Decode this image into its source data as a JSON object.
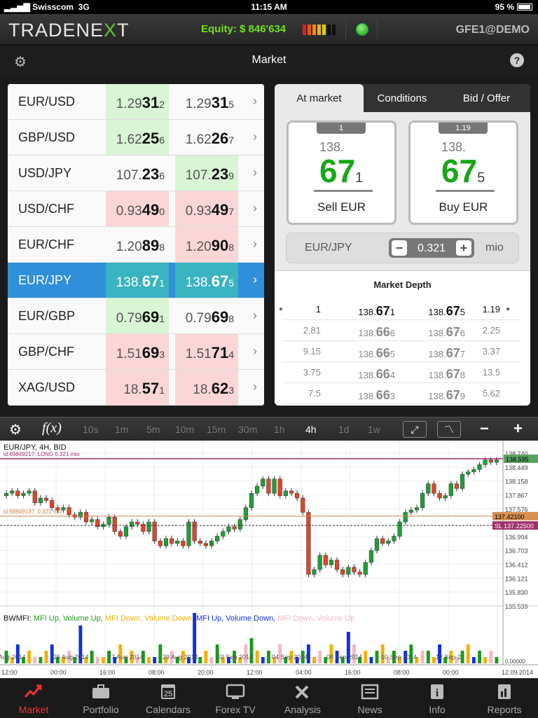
{
  "status": {
    "carrier": "Swisscom",
    "network": "3G",
    "time": "11:15 AM",
    "battery": "95 %"
  },
  "header": {
    "logo": "TRADENEXT",
    "equity": "Equity: $ 846'634",
    "user": "GFE1@DEMO"
  },
  "title": "Market",
  "quotes": [
    {
      "symbol": "EUR/USD",
      "bid_pre": "1.29",
      "bid_big": "31",
      "bid_sm": "2",
      "ask_pre": "1.29",
      "ask_big": "31",
      "ask_sm": "5",
      "bid_dir": "up",
      "ask_dir": ""
    },
    {
      "symbol": "GBP/USD",
      "bid_pre": "1.62",
      "bid_big": "25",
      "bid_sm": "6",
      "ask_pre": "1.62",
      "ask_big": "26",
      "ask_sm": "7",
      "bid_dir": "up",
      "ask_dir": ""
    },
    {
      "symbol": "USD/JPY",
      "bid_pre": "107.",
      "bid_big": "23",
      "bid_sm": "6",
      "ask_pre": "107.",
      "ask_big": "23",
      "ask_sm": "9",
      "bid_dir": "",
      "ask_dir": "up"
    },
    {
      "symbol": "USD/CHF",
      "bid_pre": "0.93",
      "bid_big": "49",
      "bid_sm": "0",
      "ask_pre": "0.93",
      "ask_big": "49",
      "ask_sm": "7",
      "bid_dir": "dn",
      "ask_dir": "dn"
    },
    {
      "symbol": "EUR/CHF",
      "bid_pre": "1.20",
      "bid_big": "89",
      "bid_sm": "8",
      "ask_pre": "1.20",
      "ask_big": "90",
      "ask_sm": "8",
      "bid_dir": "",
      "ask_dir": "dn"
    },
    {
      "symbol": "EUR/JPY",
      "bid_pre": "138.",
      "bid_big": "67",
      "bid_sm": "1",
      "ask_pre": "138.",
      "ask_big": "67",
      "ask_sm": "5",
      "bid_dir": "",
      "ask_dir": ""
    },
    {
      "symbol": "EUR/GBP",
      "bid_pre": "0.79",
      "bid_big": "69",
      "bid_sm": "1",
      "ask_pre": "0.79",
      "ask_big": "69",
      "ask_sm": "8",
      "bid_dir": "up",
      "ask_dir": ""
    },
    {
      "symbol": "GBP/CHF",
      "bid_pre": "1.51",
      "bid_big": "69",
      "bid_sm": "3",
      "ask_pre": "1.51",
      "ask_big": "71",
      "ask_sm": "4",
      "bid_dir": "dn",
      "ask_dir": "dn"
    },
    {
      "symbol": "XAG/USD",
      "bid_pre": "18.",
      "bid_big": "57",
      "bid_sm": "1",
      "ask_pre": "18.",
      "ask_big": "62",
      "ask_sm": "3",
      "bid_dir": "dn",
      "ask_dir": "dn"
    }
  ],
  "selected_symbol": "EUR/JPY",
  "panel": {
    "tabs": [
      "At market",
      "Conditions",
      "Bid / Offer"
    ],
    "sell": {
      "header": "1",
      "pre": "138.",
      "pip": "67",
      "sm": "1",
      "label": "Sell EUR"
    },
    "buy": {
      "header": "1.19",
      "pre": "138.",
      "pip": "67",
      "sm": "5",
      "label": "Buy EUR"
    },
    "amount": {
      "pair": "EUR/JPY",
      "minus": "−",
      "value": "0.321",
      "plus": "+",
      "unit": "mio"
    },
    "depth": {
      "title": "Market Depth",
      "rows": [
        {
          "q1": "1",
          "p1pre": "138.",
          "p1big": "67",
          "p1sm": "1",
          "p2pre": "138.",
          "p2big": "67",
          "p2sm": "5",
          "q2": "1.19"
        },
        {
          "q1": "2.81",
          "p1pre": "138.",
          "p1big": "66",
          "p1sm": "6",
          "p2pre": "138.",
          "p2big": "67",
          "p2sm": "6",
          "q2": "2.25"
        },
        {
          "q1": "9.15",
          "p1pre": "138.",
          "p1big": "66",
          "p1sm": "5",
          "p2pre": "138.",
          "p2big": "67",
          "p2sm": "7",
          "q2": "3.37"
        },
        {
          "q1": "3.75",
          "p1pre": "138.",
          "p1big": "66",
          "p1sm": "4",
          "p2pre": "138.",
          "p2big": "67",
          "p2sm": "8",
          "q2": "13.5"
        },
        {
          "q1": "7.5",
          "p1pre": "138.",
          "p1big": "66",
          "p1sm": "3",
          "p2pre": "138.",
          "p2big": "67",
          "p2sm": "9",
          "q2": "5.62"
        }
      ]
    }
  },
  "chart_toolbar": {
    "fx": "f(x)",
    "timeframes": [
      "10s",
      "1m",
      "5m",
      "10m",
      "15m",
      "30m",
      "1h",
      "4h",
      "1d",
      "1w"
    ],
    "active": "4h",
    "minus": "−",
    "plus": "+"
  },
  "chart_data": {
    "type": "candlestick",
    "title": "EUR/JPY, 4H, BID",
    "position_label": "id:6984921?, LONG 0.321 mio",
    "order_label": "id:6984913?, 0.321 mio",
    "yticks": [
      "138.740",
      "138.449",
      "138.158",
      "137.867",
      "137.576",
      "136.994",
      "136.703",
      "136.412",
      "136.121",
      "135.830",
      "135.539"
    ],
    "ylim": [
      135.539,
      138.74
    ],
    "current_price": "138.595",
    "order_level": "137.42100",
    "sl_level": "SL 137.22500",
    "xticks": [
      "12:00",
      "00:00",
      "16:00",
      "08:00",
      "20:00",
      "12:00",
      "04:00",
      "16:00",
      "08:00",
      "00:00",
      "12.09.2014"
    ],
    "date_labels": [
      "Aug 2014",
      "25 Aug 2014",
      "27 Aug 2014",
      "29 Aug 2014",
      "02 Sep 2014",
      "04 Sep 2014",
      "08 Sep 2014",
      "10 Sep 2014",
      "12 Sep 2"
    ],
    "indicator": {
      "title": "BWMFI:",
      "legend": [
        "MFI Up, Volume Up,",
        "MFI Down, Volume Down,",
        "MFI Up, Volume Down,",
        "MFI Down, Volume Up"
      ],
      "colors": [
        "#1a9a1a",
        "#f0b000",
        "#1030e0",
        "#f5b6c6"
      ],
      "baseline": "0.00000"
    },
    "closes": [
      137.9,
      137.95,
      137.85,
      137.9,
      137.95,
      137.7,
      137.8,
      137.75,
      137.6,
      137.55,
      137.6,
      137.45,
      137.4,
      137.5,
      137.3,
      137.35,
      137.2,
      137.25,
      137.4,
      137.1,
      137.0,
      137.2,
      137.3,
      137.25,
      137.1,
      137.3,
      136.9,
      136.8,
      136.95,
      136.85,
      136.9,
      136.8,
      137.3,
      136.9,
      136.85,
      136.8,
      136.9,
      137.0,
      137.1,
      137.2,
      137.15,
      137.35,
      137.6,
      137.9,
      138.05,
      138.2,
      137.9,
      138.2,
      137.85,
      137.95,
      137.9,
      137.8,
      137.5,
      136.2,
      136.3,
      136.6,
      136.4,
      136.5,
      136.3,
      136.2,
      136.35,
      136.25,
      136.2,
      136.45,
      136.7,
      136.95,
      136.85,
      136.9,
      137.0,
      137.3,
      137.5,
      137.55,
      137.6,
      137.9,
      138.1,
      137.9,
      137.8,
      137.85,
      138.1,
      138.0,
      138.3,
      138.35,
      138.4,
      138.5,
      138.6,
      138.55,
      138.6
    ],
    "volumes": [
      2,
      1,
      3,
      1,
      2,
      1,
      1,
      2,
      3,
      1,
      1,
      2,
      1,
      6,
      1,
      2,
      1,
      1,
      2,
      1,
      3,
      1,
      2,
      1,
      2,
      1,
      1,
      3,
      1,
      2,
      1,
      2,
      1,
      8,
      1,
      2,
      1,
      3,
      1,
      1,
      2,
      1,
      3,
      4,
      2,
      1,
      2,
      1,
      3,
      1,
      2,
      1,
      2,
      3,
      1,
      2,
      1,
      3,
      2,
      1,
      5,
      3,
      1,
      2,
      1,
      2,
      3,
      1,
      2,
      1,
      2,
      3,
      1,
      2,
      2,
      1,
      3,
      1,
      2,
      1,
      2,
      3,
      1,
      2,
      1,
      2,
      1
    ],
    "vol_types": [
      0,
      1,
      2,
      0,
      1,
      3,
      0,
      1,
      2,
      0,
      1,
      3,
      0,
      2,
      1,
      0,
      3,
      1,
      0,
      2,
      1,
      0,
      1,
      3,
      0,
      1,
      2,
      0,
      1,
      3,
      0,
      1,
      2,
      2,
      0,
      1,
      3,
      0,
      1,
      2,
      0,
      1,
      3,
      0,
      1,
      2,
      0,
      1,
      3,
      0,
      1,
      2,
      0,
      2,
      1,
      3,
      0,
      1,
      2,
      0,
      2,
      3,
      0,
      1,
      2,
      0,
      1,
      3,
      0,
      1,
      2,
      0,
      1,
      3,
      0,
      1,
      2,
      0,
      1,
      3,
      0,
      1,
      2,
      0,
      1,
      3,
      0
    ]
  },
  "nav": [
    "Market",
    "Portfolio",
    "Calendars",
    "Forex TV",
    "Analysis",
    "News",
    "Info",
    "Reports"
  ],
  "nav_active": "Market",
  "calendar_day": "25",
  "colors": {
    "equity": "#6fe020",
    "selected": "#2f8fd8",
    "up": "#d8f5d4",
    "down": "#fbd6d6",
    "pip": "#1aa61a",
    "candle_up": "#1f9e3a",
    "candle_dn": "#e0442a",
    "nav_active": "#e33"
  }
}
